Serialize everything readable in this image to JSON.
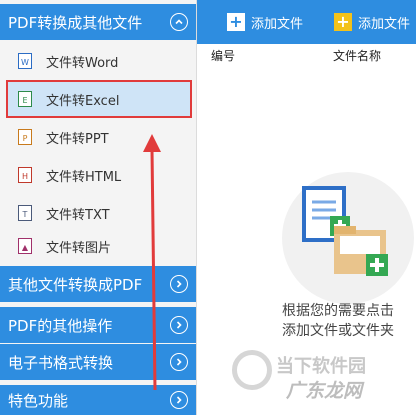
{
  "sidebar": {
    "sections": [
      {
        "title": "PDF转换成其他文件",
        "expanded": true
      },
      {
        "title": "其他文件转换成PDF",
        "expanded": false
      },
      {
        "title": "PDF的其他操作",
        "expanded": false
      },
      {
        "title": "电子书格式转换",
        "expanded": false
      },
      {
        "title": "特色功能",
        "expanded": false
      }
    ],
    "items": [
      {
        "label": "文件转Word",
        "icon": "word-file-icon"
      },
      {
        "label": "文件转Excel",
        "icon": "excel-file-icon",
        "selected": true
      },
      {
        "label": "文件转PPT",
        "icon": "ppt-file-icon"
      },
      {
        "label": "文件转HTML",
        "icon": "html-file-icon"
      },
      {
        "label": "文件转TXT",
        "icon": "txt-file-icon"
      },
      {
        "label": "文件转图片",
        "icon": "image-file-icon"
      }
    ]
  },
  "toolbar": {
    "add_file": "添加文件",
    "add_folder": "添加文件"
  },
  "table": {
    "columns": [
      "编号",
      "文件名称"
    ]
  },
  "empty_state": {
    "line1": "根据您的需要点击",
    "line2": "添加文件或文件夹"
  },
  "watermark": {
    "text1": "当下软件园",
    "text2": "广东龙网"
  },
  "colors": {
    "accent": "#2e8de0",
    "selection_bg": "#cfe4f7",
    "highlight_red": "#e13b3b"
  }
}
